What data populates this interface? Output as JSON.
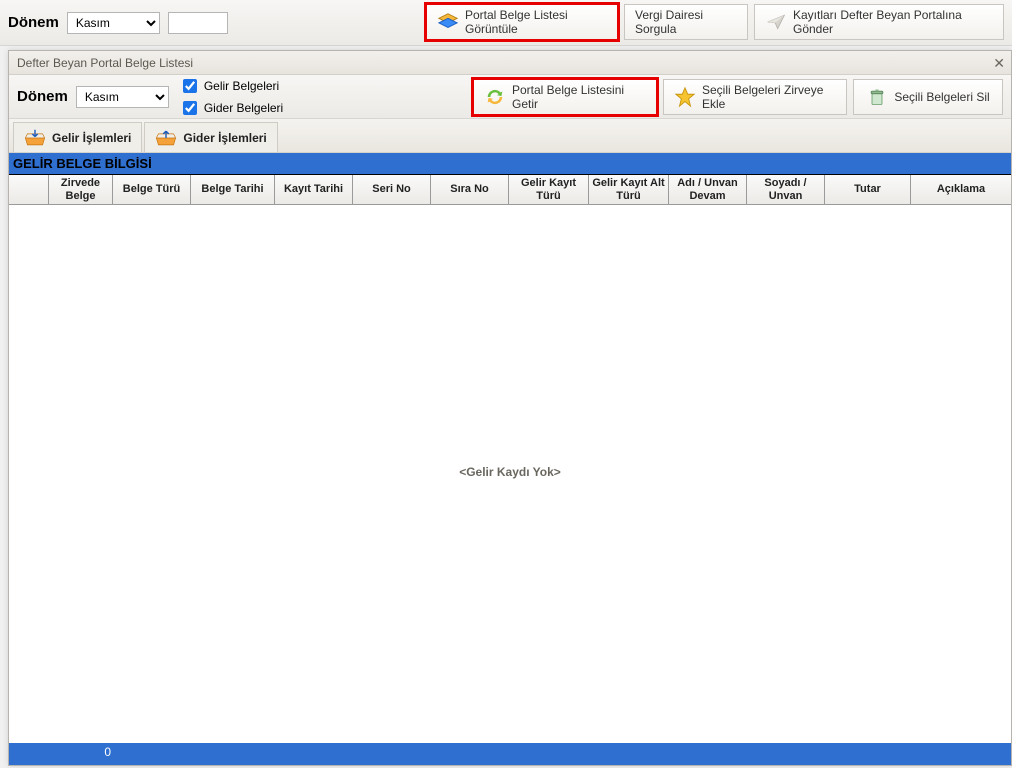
{
  "top": {
    "donem_label": "Dönem",
    "donem_value": "Kasım",
    "donem_options": [
      "Kasım"
    ],
    "empty_value": "",
    "btn_portal_goruntule": "Portal Belge Listesi Görüntüle",
    "btn_vergi_sorgula": "Vergi Dairesi Sorgula",
    "btn_kayitlari_gonder": "Kayıtları Defter Beyan Portalına Gönder"
  },
  "window": {
    "title": "Defter Beyan Portal Belge Listesi",
    "close": "✕"
  },
  "filter": {
    "donem_label": "Dönem",
    "donem_value": "Kasım",
    "chk_gelir": "Gelir Belgeleri",
    "chk_gider": "Gider Belgeleri",
    "btn_getir": "Portal Belge Listesini Getir",
    "btn_zirve": "Seçili Belgeleri Zirveye Ekle",
    "btn_sil": "Seçili Belgeleri Sil"
  },
  "tabs": {
    "gelir": "Gelir İşlemleri",
    "gider": "Gider İşlemleri"
  },
  "section_header": "GELİR BELGE BİLGİSİ",
  "columns": [
    "",
    "Zirvede Belge",
    "Belge Türü",
    "Belge Tarihi",
    "Kayıt Tarihi",
    "Seri No",
    "Sıra No",
    "Gelir Kayıt Türü",
    "Gelir Kayıt Alt Türü",
    "Adı / Unvan Devam",
    "Soyadı / Unvan",
    "Tutar",
    "Açıklama"
  ],
  "grid": {
    "rows": [],
    "no_data": "<Gelir Kaydı Yok>"
  },
  "status": {
    "count": "0"
  }
}
